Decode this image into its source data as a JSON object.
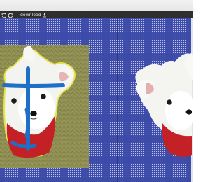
{
  "toolbar": {
    "undo_icon": "undo-icon",
    "redo_icon": "redo-icon",
    "download_label": "download",
    "download_icon": "download-icon"
  },
  "colors": {
    "toolbar_bg": "#2f2f2f",
    "canvas_bg": "#3c4aa8",
    "photo_bg": "#8a8a4c",
    "brush_stroke": "#1e6fc8",
    "selection_outline": "#e6e24a"
  }
}
